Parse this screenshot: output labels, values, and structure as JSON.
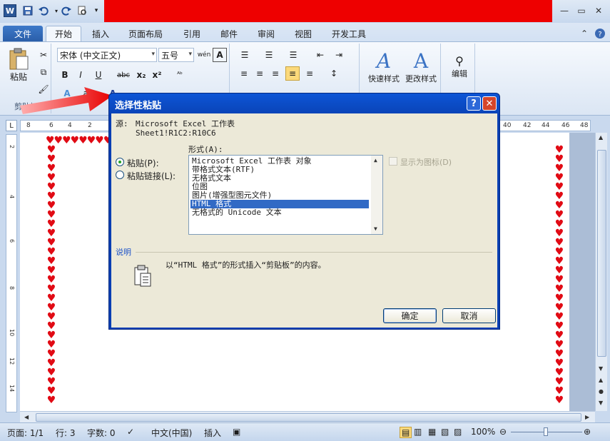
{
  "window": {
    "qat_icons": [
      "word-app-icon",
      "save-icon",
      "undo-icon",
      "redo-icon",
      "print-preview-icon",
      "customize-qat-icon"
    ],
    "controls": [
      "minimize",
      "maximize",
      "close"
    ]
  },
  "ribbon_tabs": [
    "文件",
    "开始",
    "插入",
    "页面布局",
    "引用",
    "邮件",
    "审阅",
    "视图",
    "开发工具"
  ],
  "active_tab": "开始",
  "ribbon": {
    "paste_label": "粘贴",
    "clipboard_group": "剪贴板",
    "font_name": "宋体 (中文正文)",
    "font_size": "五号",
    "quick_styles": "快速样式",
    "change_styles": "更改样式",
    "edit": "编辑",
    "bold": "B",
    "italic": "I",
    "underline": "U",
    "strike": "abc",
    "subscript": "x₂",
    "superscript": "x²",
    "font_color": "A"
  },
  "ruler": {
    "h_ticks": [
      "8",
      "6",
      "4",
      "2",
      "40",
      "42",
      "44",
      "46",
      "48"
    ],
    "v_ticks": [
      "2",
      "4",
      "6",
      "8",
      "10",
      "12",
      "14"
    ]
  },
  "document": {
    "border_symbol": "♥"
  },
  "dialog": {
    "title": "选择性粘贴",
    "help": "?",
    "close": "✕",
    "source_label": "源:",
    "source_app": "Microsoft Excel 工作表",
    "source_ref": "Sheet1!R1C2:R10C6",
    "as_label": "形式(A):",
    "paste_option": "粘贴(P):",
    "paste_link_option": "粘贴链接(L):",
    "formats": [
      "Microsoft Excel 工作表 对象",
      "带格式文本(RTF)",
      "无格式文本",
      "位图",
      "图片(增强型图元文件)",
      "HTML 格式",
      "无格式的 Unicode 文本"
    ],
    "selected_format_index": 5,
    "display_as_icon": "显示为图标(D)",
    "result_label": "说明",
    "result_text": "以“HTML 格式”的形式插入“剪贴板”的内容。",
    "ok": "确定",
    "cancel": "取消"
  },
  "statusbar": {
    "page": "页面: 1/1",
    "line": "行: 3",
    "words": "字数: 0",
    "language": "中文(中国)",
    "insert_mode": "插入",
    "zoom": "100%"
  },
  "colors": {
    "title_red": "#ee0000",
    "heart_red": "#e10a14",
    "dialog_blue": "#0a44b8",
    "selection_blue": "#316ac5"
  }
}
